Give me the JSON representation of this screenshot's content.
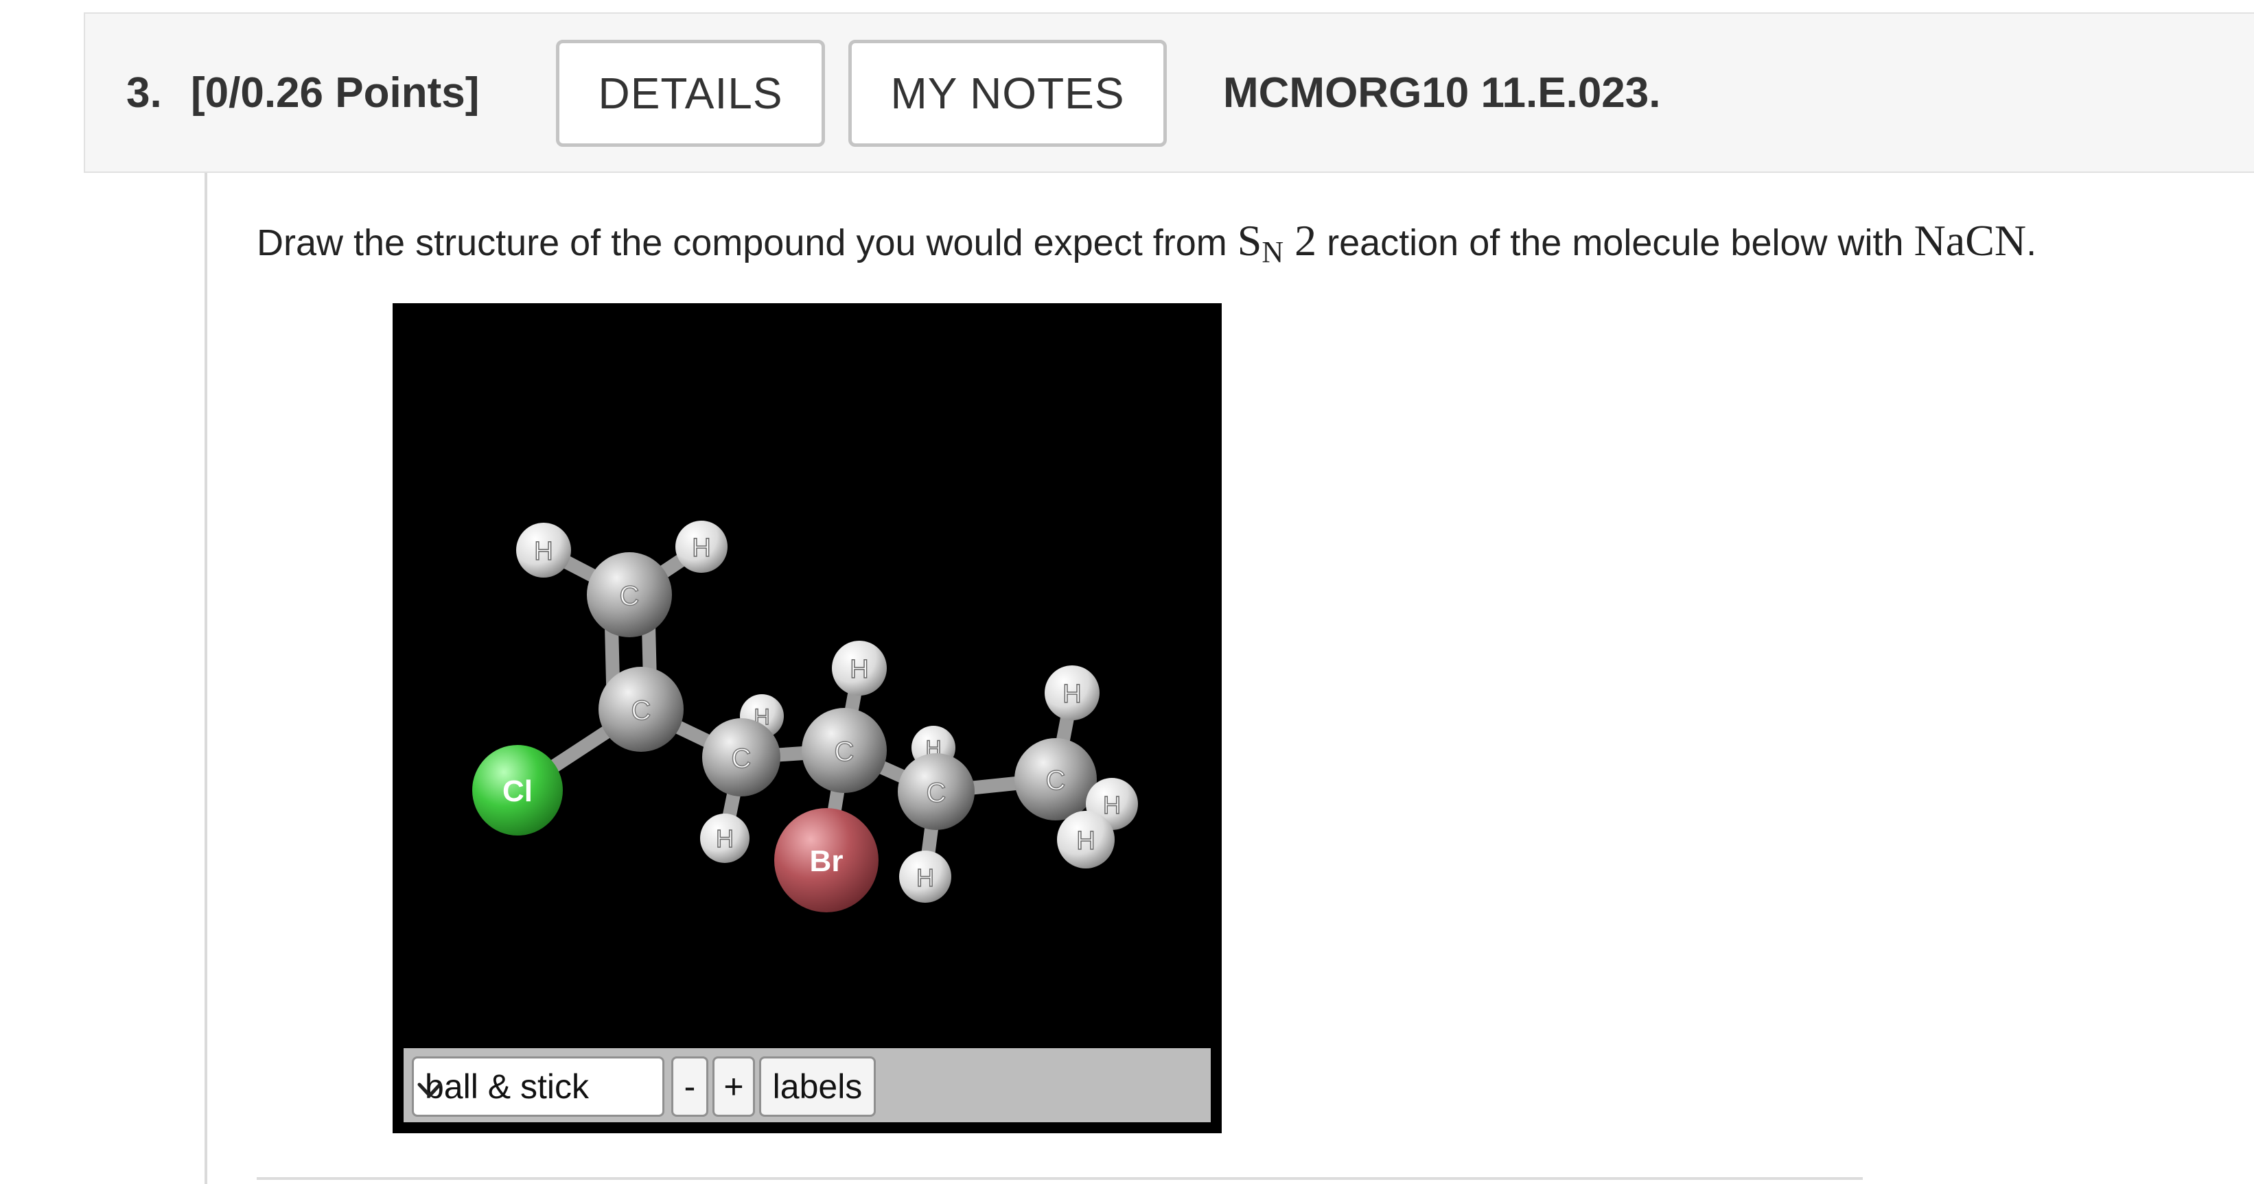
{
  "question": {
    "number": "3.",
    "points": "[0/0.26 Points]",
    "details_label": "DETAILS",
    "notes_label": "MY NOTES",
    "code": "MCMORG10 11.E.023."
  },
  "prompt": {
    "before": "Draw the structure of the compound you would expect from ",
    "sn_s": "S",
    "sn_n": "N",
    "sn_2": "2",
    "middle": " reaction of the molecule below with ",
    "reagent": "NaCN",
    "end": "."
  },
  "viewer": {
    "style_selected": "ball & stick",
    "zoom_out_label": "-",
    "zoom_in_label": "+",
    "labels_button": "labels",
    "atom_labels": {
      "h": "H",
      "c": "C",
      "cl": "Cl",
      "br": "Br"
    },
    "colors": {
      "background": "#000000",
      "carbon": "#9a9a9a",
      "hydrogen": "#e8e8e8",
      "chlorine": "#3fc93f",
      "bromine": "#b5545a"
    }
  }
}
